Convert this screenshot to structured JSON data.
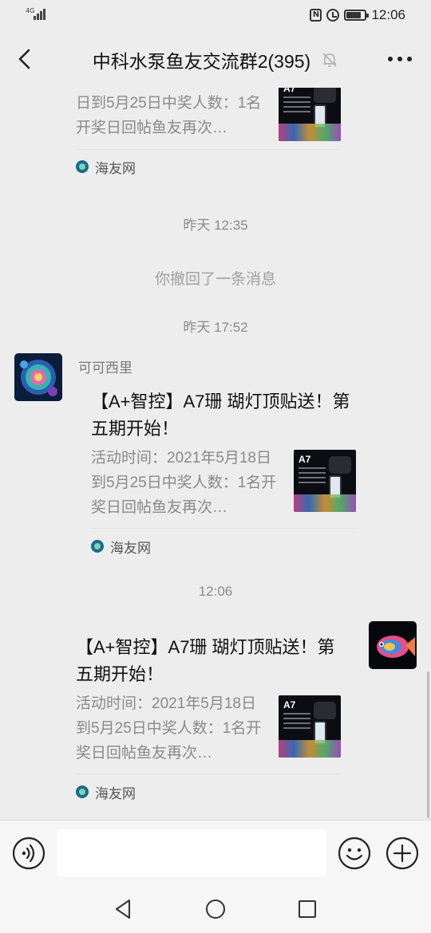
{
  "status_bar": {
    "network": "4G",
    "time": "12:06",
    "icons": [
      "signal-icon",
      "nfc-icon",
      "alarm-icon",
      "battery-icon"
    ]
  },
  "header": {
    "title": "中科水泵鱼友交流群2(395)",
    "icons": [
      "back-icon",
      "mute-icon",
      "more-icon"
    ]
  },
  "messages": {
    "partial_card": {
      "desc": "日到5月25日中奖人数：1名开奖日回帖鱼友再次…",
      "source": "海友网",
      "thumb_brand": "A7"
    },
    "time_1": "昨天 12:35",
    "recall_notice": "你撤回了一条消息",
    "time_2": "昨天 17:52",
    "card_1": {
      "sender": "可可西里",
      "title": "【A+智控】A7珊 瑚灯顶贴送！第五期开始！",
      "desc": "活动时间：2021年5月18日到5月25日中奖人数：1名开奖日回帖鱼友再次…",
      "source": "海友网",
      "thumb_brand": "A7"
    },
    "time_3": "12:06",
    "card_2": {
      "title": "【A+智控】A7珊 瑚灯顶贴送！第五期开始！",
      "desc": "活动时间：2021年5月18日到5月25日中奖人数：1名开奖日回帖鱼友再次…",
      "source": "海友网",
      "thumb_brand": "A7"
    }
  },
  "input_bar": {
    "value": "",
    "icons": [
      "voice-icon",
      "emoji-icon",
      "plus-icon"
    ]
  },
  "nav_bar": {
    "icons": [
      "back-triangle-icon",
      "home-circle-icon",
      "recents-square-icon"
    ]
  },
  "colors": {
    "background": "#ededed",
    "bubble": "#ffffff",
    "muted_text": "#8a8a8a"
  }
}
